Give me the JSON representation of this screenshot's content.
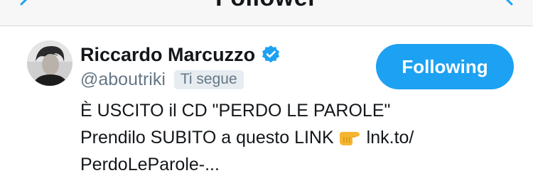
{
  "nav": {
    "title": "Follower"
  },
  "user": {
    "name": "Riccardo Marcuzzo",
    "handle": "@aboutriki",
    "follows_you_badge": "Ti segue",
    "follow_button_label": "Following",
    "bio_line_1": "È USCITO il CD \"PERDO LE PAROLE\"",
    "bio_line_2_prefix": "Prendilo SUBITO a questo LINK",
    "bio_line_2_link": "lnk.to/",
    "bio_line_3": "PerdoLeParole-..."
  },
  "colors": {
    "accent": "#1da1f2",
    "text_primary": "#14171a",
    "text_secondary": "#657786",
    "badge_bg": "#e6ecf0"
  },
  "icons": {
    "back": "chevron-left-icon",
    "forward": "chevron-right-icon",
    "verified": "verified-badge-icon",
    "pointer": "pointing-right-hand-emoji"
  }
}
